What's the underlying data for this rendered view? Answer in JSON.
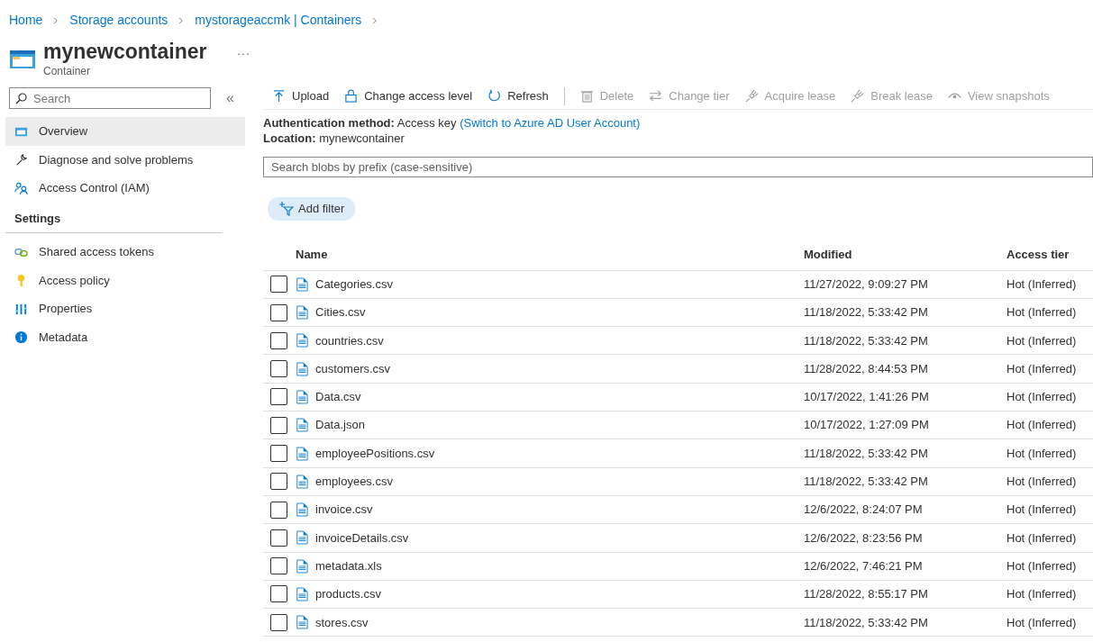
{
  "breadcrumb": [
    {
      "label": "Home"
    },
    {
      "label": "Storage accounts"
    },
    {
      "label": "mystorageaccmk | Containers"
    }
  ],
  "header": {
    "title": "mynewcontainer",
    "subtitle": "Container",
    "more": "···"
  },
  "sidebar": {
    "search": {
      "placeholder": "Search"
    },
    "collapse": "«",
    "items": [
      {
        "label": "Overview",
        "kind": "container",
        "selected": true
      },
      {
        "label": "Diagnose and solve problems",
        "kind": "wrench",
        "selected": false
      },
      {
        "label": "Access Control (IAM)",
        "kind": "people",
        "selected": false
      }
    ],
    "sections": [
      {
        "title": "Settings",
        "items": [
          {
            "label": "Shared access tokens",
            "kind": "link",
            "selected": false
          },
          {
            "label": "Access policy",
            "kind": "key",
            "selected": false
          },
          {
            "label": "Properties",
            "kind": "bars",
            "selected": false
          },
          {
            "label": "Metadata",
            "kind": "info",
            "selected": false
          }
        ]
      }
    ]
  },
  "toolbar": [
    {
      "label": "Upload",
      "kind": "upload",
      "disabled": false
    },
    {
      "label": "Change access level",
      "kind": "lock",
      "disabled": false
    },
    {
      "label": "Refresh",
      "kind": "refresh",
      "disabled": false
    },
    {
      "label": "Delete",
      "kind": "trash",
      "disabled": true
    },
    {
      "label": "Change tier",
      "kind": "swap",
      "disabled": true
    },
    {
      "label": "Acquire lease",
      "kind": "plug",
      "disabled": true
    },
    {
      "label": "Break lease",
      "kind": "plug",
      "disabled": true
    },
    {
      "label": "View snapshots",
      "kind": "eye",
      "disabled": true
    }
  ],
  "info": {
    "auth_label": "Authentication method:",
    "auth_value": "Access key",
    "auth_link": "(Switch to Azure AD User Account)",
    "location_label": "Location:",
    "location_value": "mynewcontainer"
  },
  "blob_search": {
    "placeholder": "Search blobs by prefix (case-sensitive)"
  },
  "add_filter": "Add filter",
  "table": {
    "columns": [
      "Name",
      "Modified",
      "Access tier"
    ],
    "rows": [
      {
        "name": "Categories.csv",
        "modified": "11/27/2022, 9:09:27 PM",
        "tier": "Hot (Inferred)",
        "checked": false
      },
      {
        "name": "Cities.csv",
        "modified": "11/18/2022, 5:33:42 PM",
        "tier": "Hot (Inferred)",
        "checked": false
      },
      {
        "name": "countries.csv",
        "modified": "11/18/2022, 5:33:42 PM",
        "tier": "Hot (Inferred)",
        "checked": false
      },
      {
        "name": "customers.csv",
        "modified": "11/28/2022, 8:44:53 PM",
        "tier": "Hot (Inferred)",
        "checked": false
      },
      {
        "name": "Data.csv",
        "modified": "10/17/2022, 1:41:26 PM",
        "tier": "Hot (Inferred)",
        "checked": false
      },
      {
        "name": "Data.json",
        "modified": "10/17/2022, 1:27:09 PM",
        "tier": "Hot (Inferred)",
        "checked": false
      },
      {
        "name": "employeePositions.csv",
        "modified": "11/18/2022, 5:33:42 PM",
        "tier": "Hot (Inferred)",
        "checked": false
      },
      {
        "name": "employees.csv",
        "modified": "11/18/2022, 5:33:42 PM",
        "tier": "Hot (Inferred)",
        "checked": false
      },
      {
        "name": "invoice.csv",
        "modified": "12/6/2022, 8:24:07 PM",
        "tier": "Hot (Inferred)",
        "checked": false
      },
      {
        "name": "invoiceDetails.csv",
        "modified": "12/6/2022, 8:23:56 PM",
        "tier": "Hot (Inferred)",
        "checked": false
      },
      {
        "name": "metadata.xls",
        "modified": "12/6/2022, 7:46:21 PM",
        "tier": "Hot (Inferred)",
        "checked": false
      },
      {
        "name": "products.csv",
        "modified": "11/28/2022, 8:55:17 PM",
        "tier": "Hot (Inferred)",
        "checked": false
      },
      {
        "name": "stores.csv",
        "modified": "11/18/2022, 5:33:42 PM",
        "tier": "Hot (Inferred)",
        "checked": false
      }
    ]
  }
}
